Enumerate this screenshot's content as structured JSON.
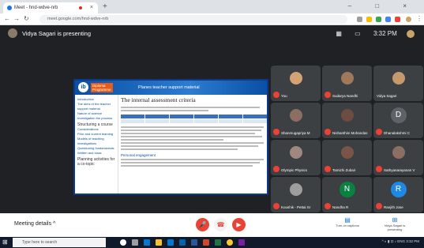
{
  "browser": {
    "tab_title": "Meet - hnd-wdve-nrb",
    "url": "meet.google.com/hnd-wdve-nrb",
    "new_tab": "+",
    "close_tab": "×",
    "window_controls": "– □ ×"
  },
  "meet": {
    "presenter_text": "Vidya Sagari is presenting",
    "time": "3:32 PM",
    "meeting_details_label": "Meeting details",
    "captions_label": "Turn on captions",
    "present_label": "Vidya Sagari is presenting"
  },
  "shared": {
    "logo_letters": "ib",
    "logo_text1": "Diploma",
    "logo_text2": "Programme",
    "header_title": "Planes teacher support material",
    "heading": "The internal assessment criteria",
    "subheading": "Personal engagement",
    "sidebar_links": [
      "Introduction",
      "The aims of the teacher support material",
      "Nature of science",
      "Investigation the process"
    ],
    "sidebar_sec1": "Structuring a course",
    "sidebar_links2": [
      "Considerations",
      "Prior and current learning",
      "Models of teaching investigations",
      "Questioning fundamentals",
      "Written and class"
    ],
    "sidebar_sec2": "Planning activities for a co-topic"
  },
  "participants": [
    {
      "name": "You",
      "color": "#d4a373",
      "letter": ""
    },
    {
      "name": "Sudarya Nandhi",
      "color": "#a0785a",
      "letter": ""
    },
    {
      "name": "Vidya Sagari",
      "color": "#c49a6c",
      "letter": ""
    },
    {
      "name": "Shanmugapriya M",
      "color": "#8d6e63",
      "letter": ""
    },
    {
      "name": "Nishanthini Mohandas",
      "color": "#6d4c41",
      "letter": ""
    },
    {
      "name": "Dhanalakshmi C",
      "color": "#5f6368",
      "letter": "D"
    },
    {
      "name": "Olympic Physics",
      "color": "#a1887f",
      "letter": ""
    },
    {
      "name": "Tamizhi Zubair",
      "color": "#795548",
      "letter": ""
    },
    {
      "name": "Sathyanarayanan V",
      "color": "#8d6e63",
      "letter": ""
    },
    {
      "name": "Koushik - Pettai Sr",
      "color": "#9e9e9e",
      "letter": ""
    },
    {
      "name": "Nandha R",
      "color": "#0b8043",
      "letter": "N"
    },
    {
      "name": "Ranjith Jose",
      "color": "#1e88e5",
      "letter": "R"
    }
  ],
  "taskbar": {
    "search_placeholder": "Type here to search",
    "clock": "3:32 PM"
  },
  "colors": {
    "end_call": "#ea4335",
    "accent": "#1a73e8"
  }
}
